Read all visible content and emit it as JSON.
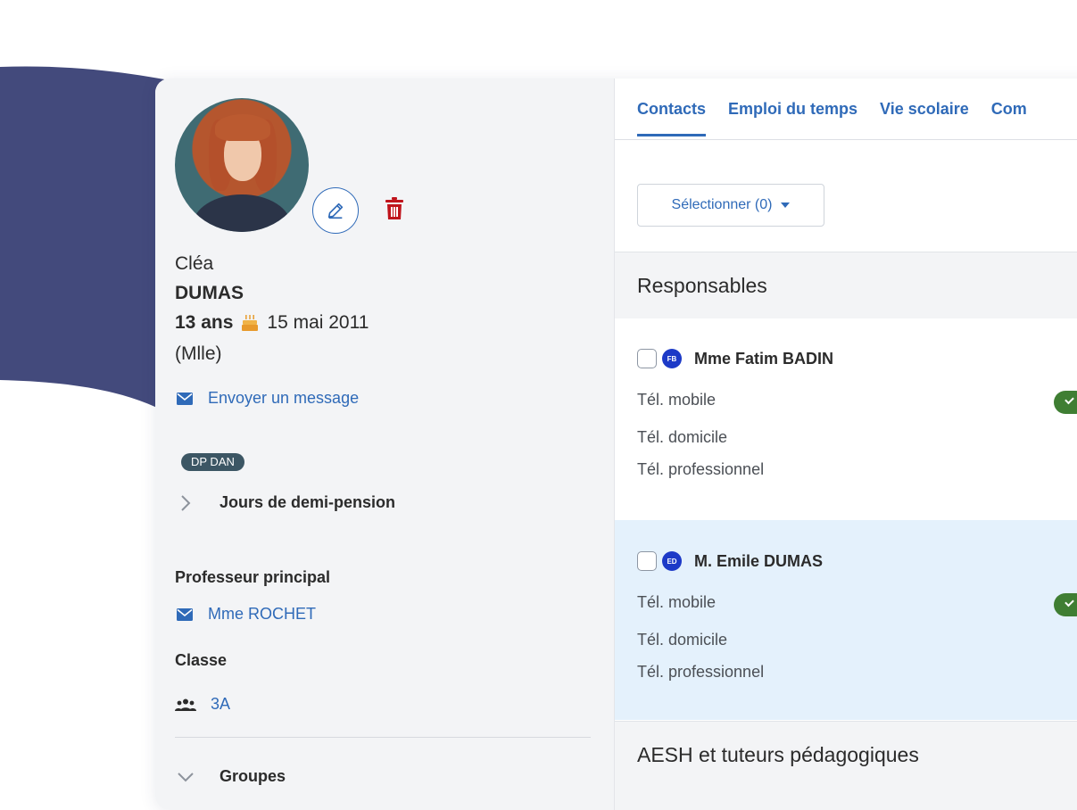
{
  "student": {
    "first_name": "Cléa",
    "last_name": "DUMAS",
    "age": "13 ans",
    "birthday": "15 mai 2011",
    "title": "(Mlle)",
    "send_message": "Envoyer un message",
    "badge": "DP DAN",
    "half_board_label": "Jours de demi-pension",
    "main_teacher_label": "Professeur principal",
    "main_teacher": "Mme ROCHET",
    "class_label": "Classe",
    "class_value": "3A",
    "groups_label": "Groupes"
  },
  "tabs": [
    {
      "label": "Contacts"
    },
    {
      "label": "Emploi du temps"
    },
    {
      "label": "Vie scolaire"
    },
    {
      "label": "Com"
    }
  ],
  "select_button": "Sélectionner (0)",
  "sections": {
    "responsables": "Responsables",
    "aesh": "AESH et tuteurs pédagogiques"
  },
  "contacts": [
    {
      "initials": "FB",
      "name": "Mme Fatim BADIN",
      "phones": [
        "Tél. mobile",
        "Tél. domicile",
        "Tél. professionnel"
      ]
    },
    {
      "initials": "ED",
      "name": "M. Emile DUMAS",
      "phones": [
        "Tél. mobile",
        "Tél. domicile",
        "Tél. professionnel"
      ]
    }
  ],
  "colors": {
    "accent": "#2f6ab8",
    "deco": "#434a7c",
    "delete": "#c0141c",
    "toggle": "#3f7e33",
    "initials_bg": "#1d3ac7"
  }
}
